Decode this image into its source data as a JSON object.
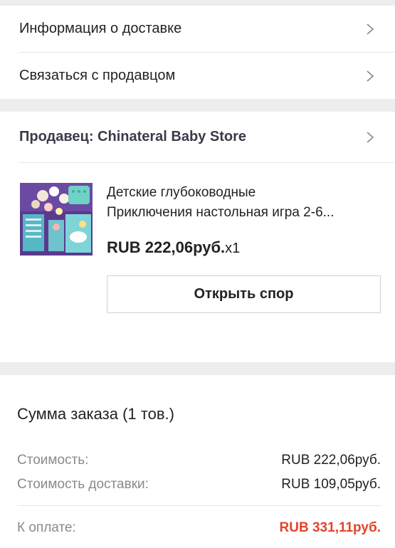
{
  "links": {
    "delivery_info": "Информация о доставке",
    "contact_seller": "Связаться с продавцом"
  },
  "seller": {
    "label": "Продавец: Chinateral Baby Store"
  },
  "product": {
    "title_line1": "Детские глубоководные",
    "title_line2": "Приключения настольная игра 2-6...",
    "price": "RUB 222,06руб.",
    "qty": "x1",
    "dispute_button": "Открыть спор"
  },
  "summary": {
    "title": "Сумма заказа (1 тов.)",
    "cost_label": "Стоимость:",
    "cost_value": "RUB 222,06руб.",
    "shipping_label": "Стоимость доставки:",
    "shipping_value": "RUB 109,05руб.",
    "total_label": "К оплате:",
    "total_value": "RUB 331,11руб."
  },
  "colors": {
    "accent_total": "#e4432d",
    "background": "#ededed"
  }
}
